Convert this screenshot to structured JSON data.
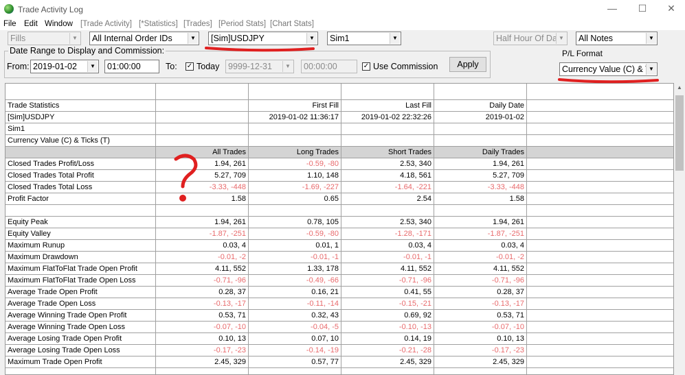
{
  "window": {
    "title": "Trade Activity Log"
  },
  "menu": [
    "File",
    "Edit",
    "Window",
    "[Trade Activity]",
    "[*Statistics]",
    "[Trades]",
    "[Period Stats]",
    "[Chart Stats]"
  ],
  "toolbar": {
    "fills": "Fills",
    "order_ids": "All Internal Order IDs",
    "symbol": "[Sim]USDJPY",
    "account": "Sim1",
    "period": "Half Hour Of Day",
    "notes": "All Notes"
  },
  "date_range": {
    "group_label": "Date Range to Display and Commission:",
    "from_label": "From:",
    "from_date": "2019-01-02",
    "from_time": "01:00:00",
    "to_label": "To:",
    "today_label": "Today",
    "today_checked": true,
    "to_date": "9999-12-31",
    "to_time": "00:00:00",
    "use_commission_label": "Use Commission",
    "use_commission_checked": true,
    "apply": "Apply"
  },
  "pl_format": {
    "label": "P/L Format",
    "value": "Currency Value (C) & T"
  },
  "info_rows": [
    [
      "Trade Statistics",
      "",
      "First Fill",
      "Last Fill",
      "Daily Date"
    ],
    [
      "[Sim]USDJPY",
      "",
      "2019-01-02  11:36:17",
      "2019-01-02  22:32:26",
      "2019-01-02"
    ],
    [
      "Sim1",
      "",
      "",
      "",
      ""
    ],
    [
      "Currency Value (C) & Ticks (T)",
      "",
      "",
      "",
      ""
    ]
  ],
  "columns": [
    "",
    "All Trades",
    "Long Trades",
    "Short Trades",
    "Daily Trades"
  ],
  "stat_rows": [
    [
      "Closed Trades Profit/Loss",
      "1.94, 261",
      "-0.59, -80",
      "2.53, 340",
      "1.94, 261"
    ],
    [
      "Closed Trades Total Profit",
      "5.27, 709",
      "1.10, 148",
      "4.18, 561",
      "5.27, 709"
    ],
    [
      "Closed Trades Total Loss",
      "-3.33, -448",
      "-1.69, -227",
      "-1.64, -221",
      "-3.33, -448"
    ],
    [
      "Profit Factor",
      "1.58",
      "0.65",
      "2.54",
      "1.58"
    ],
    [
      "",
      "",
      "",
      "",
      ""
    ],
    [
      "Equity Peak",
      "1.94, 261",
      "0.78, 105",
      "2.53, 340",
      "1.94, 261"
    ],
    [
      "Equity Valley",
      "-1.87, -251",
      "-0.59, -80",
      "-1.28, -171",
      "-1.87, -251"
    ],
    [
      "Maximum Runup",
      "0.03, 4",
      "0.01, 1",
      "0.03, 4",
      "0.03, 4"
    ],
    [
      "Maximum Drawdown",
      "-0.01, -2",
      "-0.01, -1",
      "-0.01, -1",
      "-0.01, -2"
    ],
    [
      "Maximum FlatToFlat Trade Open Profit",
      "4.11, 552",
      "1.33, 178",
      "4.11, 552",
      "4.11, 552"
    ],
    [
      "Maximum FlatToFlat Trade Open Loss",
      "-0.71, -96",
      "-0.49, -66",
      "-0.71, -96",
      "-0.71, -96"
    ],
    [
      "Average Trade Open Profit",
      "0.28, 37",
      "0.16, 21",
      "0.41, 55",
      "0.28, 37"
    ],
    [
      "Average Trade Open Loss",
      "-0.13, -17",
      "-0.11, -14",
      "-0.15, -21",
      "-0.13, -17"
    ],
    [
      "Average Winning Trade Open Profit",
      "0.53, 71",
      "0.32, 43",
      "0.69, 92",
      "0.53, 71"
    ],
    [
      "Average Winning Trade Open Loss",
      "-0.07, -10",
      "-0.04, -5",
      "-0.10, -13",
      "-0.07, -10"
    ],
    [
      "Average Losing Trade Open Profit",
      "0.10, 13",
      "0.07, 10",
      "0.14, 19",
      "0.10, 13"
    ],
    [
      "Average Losing Trade Open Loss",
      "-0.17, -23",
      "-0.14, -19",
      "-0.21, -28",
      "-0.17, -23"
    ],
    [
      "Maximum Trade Open Profit",
      "2.45, 329",
      "0.57, 77",
      "2.45, 329",
      "2.45, 329"
    ]
  ],
  "colors": {
    "negative": "#e8696b",
    "annotation": "#e02020"
  }
}
